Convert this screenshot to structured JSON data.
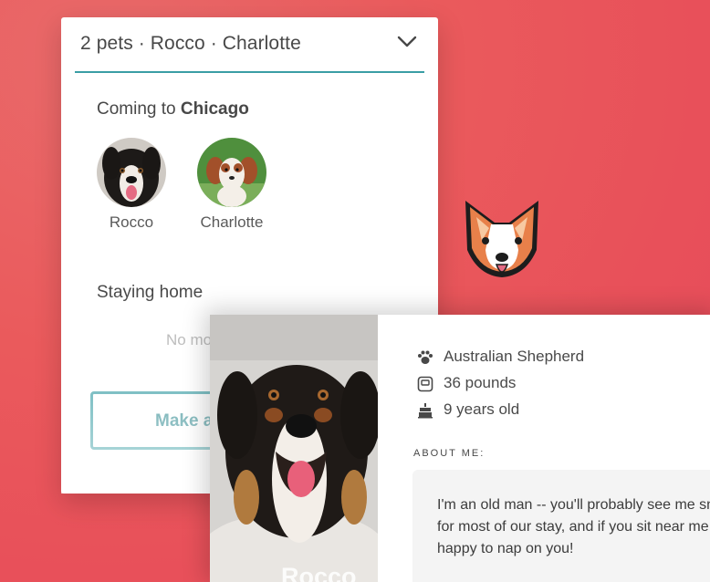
{
  "selector": {
    "dropdown_value": "2 pets · Rocco · Charlotte",
    "coming_prefix": "Coming to ",
    "coming_city": "Chicago",
    "coming_pets": [
      {
        "name": "Rocco"
      },
      {
        "name": "Charlotte"
      }
    ],
    "staying_heading": "Staying home",
    "staying_empty_text": "No mo",
    "make_button_label": "Make a"
  },
  "profile": {
    "name": "Rocco",
    "breed": "Australian Shepherd",
    "weight": "36 pounds",
    "age": "9 years old",
    "about_label": "ABOUT ME:",
    "about_text": "I'm an old man -- you'll probably see me sn for most of our stay, and if you sit near me happy to nap on you!"
  },
  "icons": {
    "dropdown": "chevron-down-icon",
    "breed": "paw-icon",
    "weight": "scale-icon",
    "age": "cake-icon",
    "logo": "corgi-logo-icon"
  },
  "colors": {
    "accent_teal": "#3a9ea5",
    "background_red": "#e8505a",
    "logo_orange": "#e8804a"
  }
}
